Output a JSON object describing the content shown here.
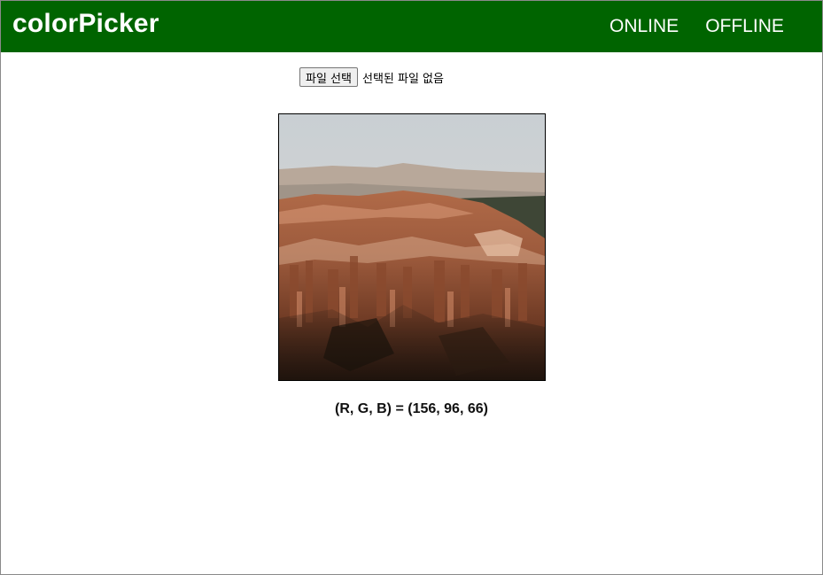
{
  "header": {
    "brand": "colorPicker",
    "nav": [
      {
        "label": "ONLINE"
      },
      {
        "label": "OFFLINE"
      }
    ],
    "background_color": "#006400"
  },
  "file_input": {
    "button_label": "파일 선택",
    "status_text": "선택된 파일 없음"
  },
  "preview": {
    "subject": "canyon landscape photo with hoodoo rock formations"
  },
  "result": {
    "rgb_text": "(R, G, B) = (156, 96, 66)"
  }
}
